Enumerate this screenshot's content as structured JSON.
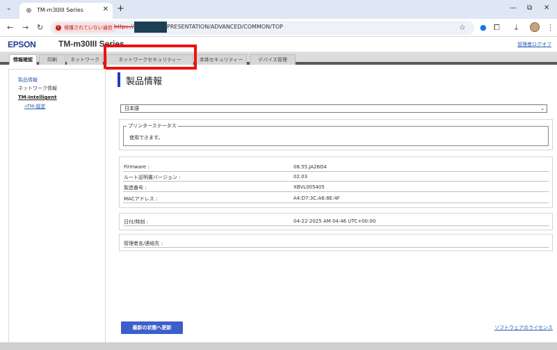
{
  "browser": {
    "tab_title": "TM-m30III Series",
    "tab_close": "✕",
    "new_tab": "+",
    "security_warning": "保護されていない通信",
    "url_scheme": "https://",
    "url_tail": "PRESENTATION/ADVANCED/COMMON/TOP"
  },
  "header": {
    "brand": "EPSON",
    "model": "TM-m30III Series",
    "logout": "管理者ログオフ"
  },
  "menu": {
    "tabs": [
      {
        "label": "情報確認"
      },
      {
        "label": "印刷"
      },
      {
        "label": "ネットワーク"
      },
      {
        "label": "ネットワークセキュリティー"
      },
      {
        "label": "本体セキュリティー"
      },
      {
        "label": "デバイス管理"
      }
    ]
  },
  "sidebar": {
    "items": [
      {
        "label": "製品情報"
      },
      {
        "label": "ネットワーク情報"
      },
      {
        "label": "TM-Intelligent"
      },
      {
        "label": "»TM-設定"
      }
    ]
  },
  "main": {
    "title": "製品情報",
    "language": "日本語",
    "printer_status_legend": "プリンターステータス",
    "printer_status_text": "使用できます。",
    "info_rows": [
      {
        "key": "Firmware :",
        "value": "08.55.JA26O4"
      },
      {
        "key": "ルート証明書バージョン :",
        "value": "02.03"
      },
      {
        "key": "製造番号 :",
        "value": "XBVL005405"
      },
      {
        "key": "MACアドレス :",
        "value": "A4:D7:3C:A6:8E:4F"
      }
    ],
    "datetime": {
      "key": "日付/時刻 :",
      "value": "04-22-2025 AM 04:46 UTC+00:00"
    },
    "admin": {
      "key": "管理者名/連絡先 :",
      "value": ""
    },
    "refresh_button": "最新の状態へ更新",
    "license_link": "ソフトウェアのライセンス"
  },
  "colors": {
    "accent": "#1b3fbf",
    "button": "#3d5fc9",
    "highlight": "#ee1111",
    "link": "#2a5db0"
  }
}
